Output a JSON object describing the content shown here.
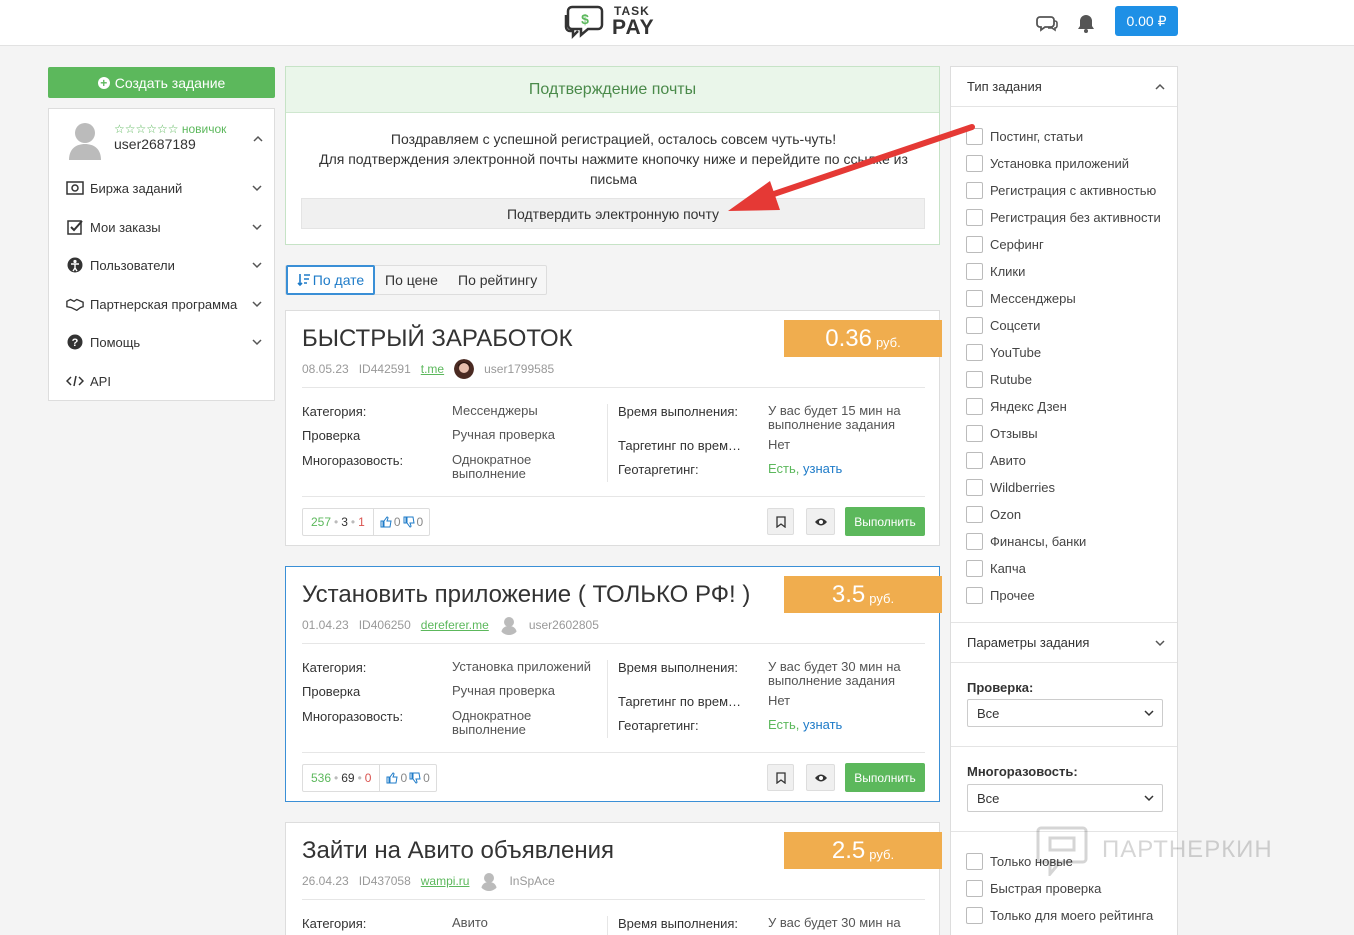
{
  "header": {
    "logo_top": "TASK",
    "logo_bottom": "PAY",
    "balance": "0.00 ₽"
  },
  "sidebar": {
    "create_label": "Создать задание",
    "rank": "☆☆☆☆☆☆ новичок",
    "username": "user2687189",
    "menu": [
      {
        "label": "Биржа заданий",
        "icon": "money-icon"
      },
      {
        "label": "Мои заказы",
        "icon": "checkbox-icon"
      },
      {
        "label": "Пользователи",
        "icon": "users-icon"
      },
      {
        "label": "Партнерская программа",
        "icon": "handshake-icon"
      },
      {
        "label": "Помощь",
        "icon": "help-icon"
      },
      {
        "label": "API",
        "icon": "code-icon"
      }
    ]
  },
  "confirm": {
    "title": "Подтверждение почты",
    "line1": "Поздравляем с успешной регистрацией, осталось совсем чуть-чуть!",
    "line2": "Для подтверждения электронной почты нажмите кнопочку ниже и перейдите по ссылке из письма",
    "button": "Подтвердить электронную почту"
  },
  "sort": {
    "by_date": "По дате",
    "by_price": "По цене",
    "by_rating": "По рейтингу"
  },
  "labels": {
    "category": "Категория:",
    "check": "Проверка",
    "reuse": "Многоразовость:",
    "time": "Время выполнения:",
    "time_target": "Таргетинг по врем…",
    "geo": "Геотаргетинг:",
    "execute": "Выполнить"
  },
  "tasks": [
    {
      "title": "БЫСТРЫЙ ЗАРАБОТОК",
      "price": "0.36",
      "currency": "руб.",
      "date": "08.05.23",
      "id": "ID442591",
      "domain": "t.me",
      "user": "user1799585",
      "category": "Мессенджеры",
      "check": "Ручная проверка",
      "reuse": "Однократное выполнение",
      "time": "У вас будет 15 мин на выполнение задания",
      "time_target": "Нет",
      "geo_yes": "Есть,",
      "geo_more": "узнать",
      "views": "257",
      "done": "3",
      "fail": "1",
      "likes": "0",
      "dislikes": "0"
    },
    {
      "title": "Установить приложение ( ТОЛЬКО РФ! )",
      "price": "3.5",
      "currency": "руб.",
      "date": "01.04.23",
      "id": "ID406250",
      "domain": "dereferer.me",
      "user": "user2602805",
      "category": "Установка приложений",
      "check": "Ручная проверка",
      "reuse": "Однократное выполнение",
      "time": "У вас будет 30 мин на выполнение задания",
      "time_target": "Нет",
      "geo_yes": "Есть,",
      "geo_more": "узнать",
      "views": "536",
      "done": "69",
      "fail": "0",
      "likes": "0",
      "dislikes": "0"
    },
    {
      "title": "Зайти на Авито объявления",
      "price": "2.5",
      "currency": "руб.",
      "date": "26.04.23",
      "id": "ID437058",
      "domain": "wampi.ru",
      "user": "InSpAce",
      "category": "Авито",
      "time": "У вас будет 30 мин на"
    }
  ],
  "filters": {
    "type_title": "Тип задания",
    "types": [
      "Постинг, статьи",
      "Установка приложений",
      "Регистрация с активностью",
      "Регистрация без активности",
      "Серфинг",
      "Клики",
      "Мессенджеры",
      "Соцсети",
      "YouTube",
      "Rutube",
      "Яндекс Дзен",
      "Отзывы",
      "Авито",
      "Wildberries",
      "Ozon",
      "Финансы, банки",
      "Капча",
      "Прочее"
    ],
    "params_title": "Параметры задания",
    "check_label": "Проверка:",
    "check_value": "Все",
    "reuse_label": "Многоразовость:",
    "reuse_value": "Все",
    "extra": [
      "Только новые",
      "Быстрая проверка",
      "Только для моего рейтинга"
    ]
  },
  "watermark": "ПАРТНЕРКИН",
  "colors": {
    "accent_green": "#5cb85c",
    "accent_blue": "#1e90e6",
    "price_orange": "#f0ad4e",
    "arrow_red": "#e53935"
  }
}
